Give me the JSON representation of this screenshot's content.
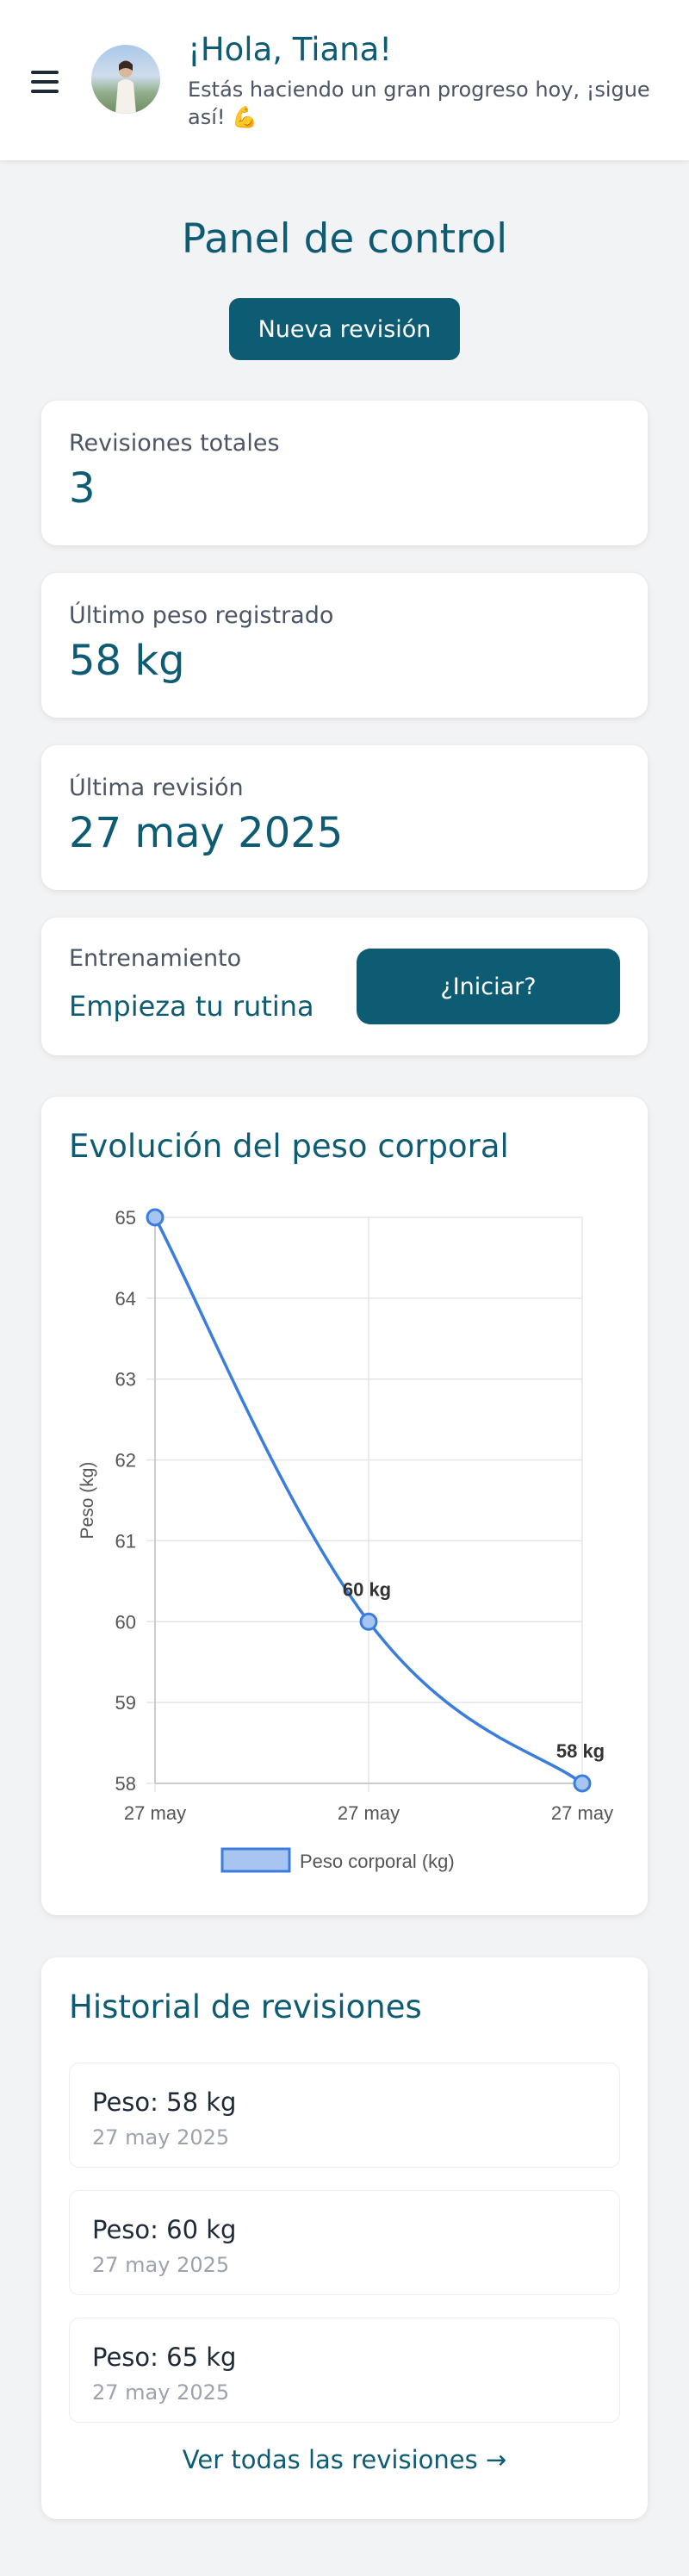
{
  "header": {
    "greeting": "¡Hola, Tiana!",
    "subtitle": "Estás haciendo un gran progreso hoy, ¡sigue así! 💪"
  },
  "page_title": "Panel de control",
  "new_review_label": "Nueva revisión",
  "stats": [
    {
      "label": "Revisiones totales",
      "value": "3"
    },
    {
      "label": "Último peso registrado",
      "value": "58 kg"
    },
    {
      "label": "Última revisión",
      "value": "27 may 2025"
    }
  ],
  "training": {
    "label": "Entrenamiento",
    "cta_text": "Empieza tu rutina",
    "button_label": "¿Iniciar?"
  },
  "chart_section": {
    "title": "Evolución del peso corporal"
  },
  "chart_data": {
    "type": "line",
    "x": [
      "27 may",
      "27 may",
      "27 may"
    ],
    "series": [
      {
        "name": "Peso corporal (kg)",
        "values": [
          65,
          60,
          58
        ],
        "data_labels": [
          "",
          "60 kg",
          "58 kg"
        ],
        "color": "#3b7ddd",
        "fill": "#a8c5f2"
      }
    ],
    "title": "",
    "xlabel": "",
    "ylabel": "Peso (kg)",
    "ylim": [
      58,
      65
    ],
    "yticks": [
      "58",
      "59",
      "60",
      "61",
      "62",
      "63",
      "64",
      "65"
    ],
    "grid": true,
    "legend": "bottom"
  },
  "history": {
    "title": "Historial de revisiones",
    "items": [
      {
        "weight": "Peso: 58 kg",
        "date": "27 may 2025"
      },
      {
        "weight": "Peso: 60 kg",
        "date": "27 may 2025"
      },
      {
        "weight": "Peso: 65 kg",
        "date": "27 may 2025"
      }
    ],
    "see_all": "Ver todas las revisiones →"
  },
  "colors": {
    "primary": "#0e5c73",
    "background": "#f2f3f5",
    "line": "#3b7ddd"
  }
}
